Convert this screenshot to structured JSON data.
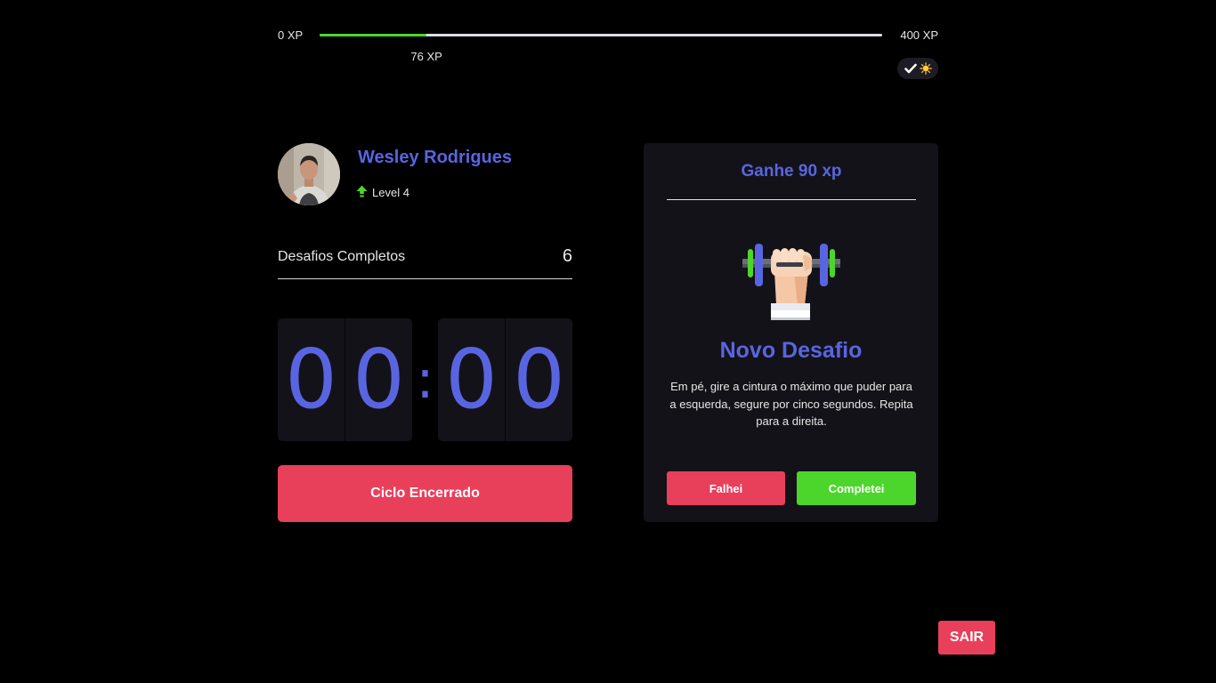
{
  "experience": {
    "min_label": "0 XP",
    "max_label": "400 XP",
    "current_label": "76 XP",
    "current": 76,
    "max": 400,
    "fill_color": "#4cd62b"
  },
  "theme_toggle": {
    "icons": [
      "check-icon",
      "sun-icon"
    ]
  },
  "profile": {
    "name": "Wesley Rodrigues",
    "level_label": "Level 4",
    "level_icon": "level-up-arrow-icon",
    "avatar": "avatar"
  },
  "completed_challenges": {
    "label": "Desafios Completos",
    "count": "6"
  },
  "countdown": {
    "minute_left": "0",
    "minute_right": "0",
    "separator": ":",
    "second_left": "0",
    "second_right": "0"
  },
  "cycle_button": {
    "label": "Ciclo Encerrado"
  },
  "challenge": {
    "header": "Ganhe 90 xp",
    "icon": "dumbbell-icon",
    "title": "Novo Desafio",
    "description": "Em pé, gire a cintura o máximo que puder para a esquerda, segure por cinco segundos. Repita para a direita.",
    "fail_label": "Falhei",
    "success_label": "Completei"
  },
  "logout": {
    "label": "SAIR"
  },
  "colors": {
    "accent": "#5965e0",
    "red": "#e83f5b",
    "green": "#4cd62b",
    "card_bg": "#131219"
  }
}
